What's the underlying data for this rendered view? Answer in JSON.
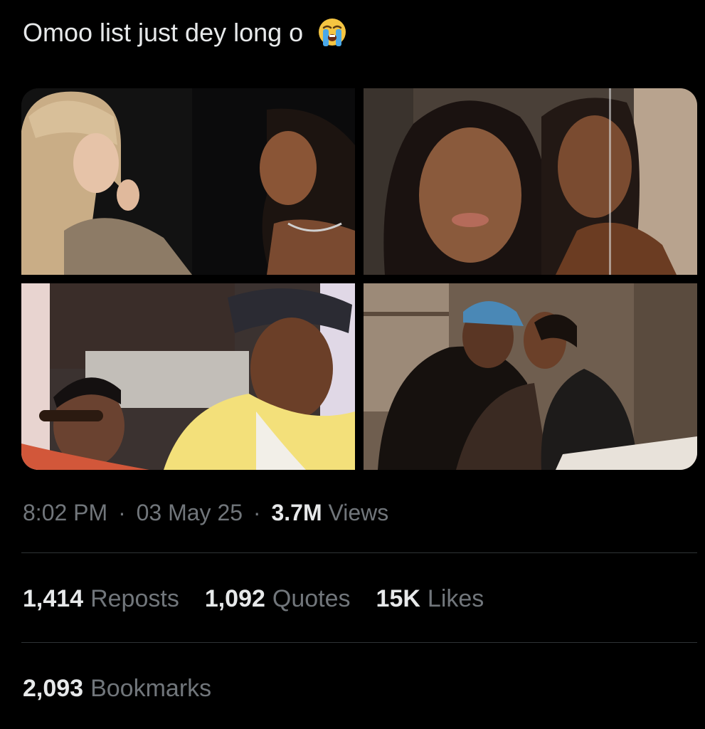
{
  "tweet": {
    "text": "Omoo list just dey long o",
    "emoji": "loudly-crying-face-icon"
  },
  "media": [
    {
      "label": "photo-1"
    },
    {
      "label": "photo-2"
    },
    {
      "label": "photo-3"
    },
    {
      "label": "photo-4"
    }
  ],
  "meta": {
    "time": "8:02 PM",
    "separator": "·",
    "date": "03 May 25",
    "views_count": "3.7M",
    "views_label": "Views"
  },
  "stats": {
    "reposts_count": "1,414",
    "reposts_label": "Reposts",
    "quotes_count": "1,092",
    "quotes_label": "Quotes",
    "likes_count": "15K",
    "likes_label": "Likes",
    "bookmarks_count": "2,093",
    "bookmarks_label": "Bookmarks"
  },
  "colors": {
    "background": "#000000",
    "primary_text": "#e7e9ea",
    "secondary_text": "#71767b",
    "divider": "#2f3336"
  }
}
